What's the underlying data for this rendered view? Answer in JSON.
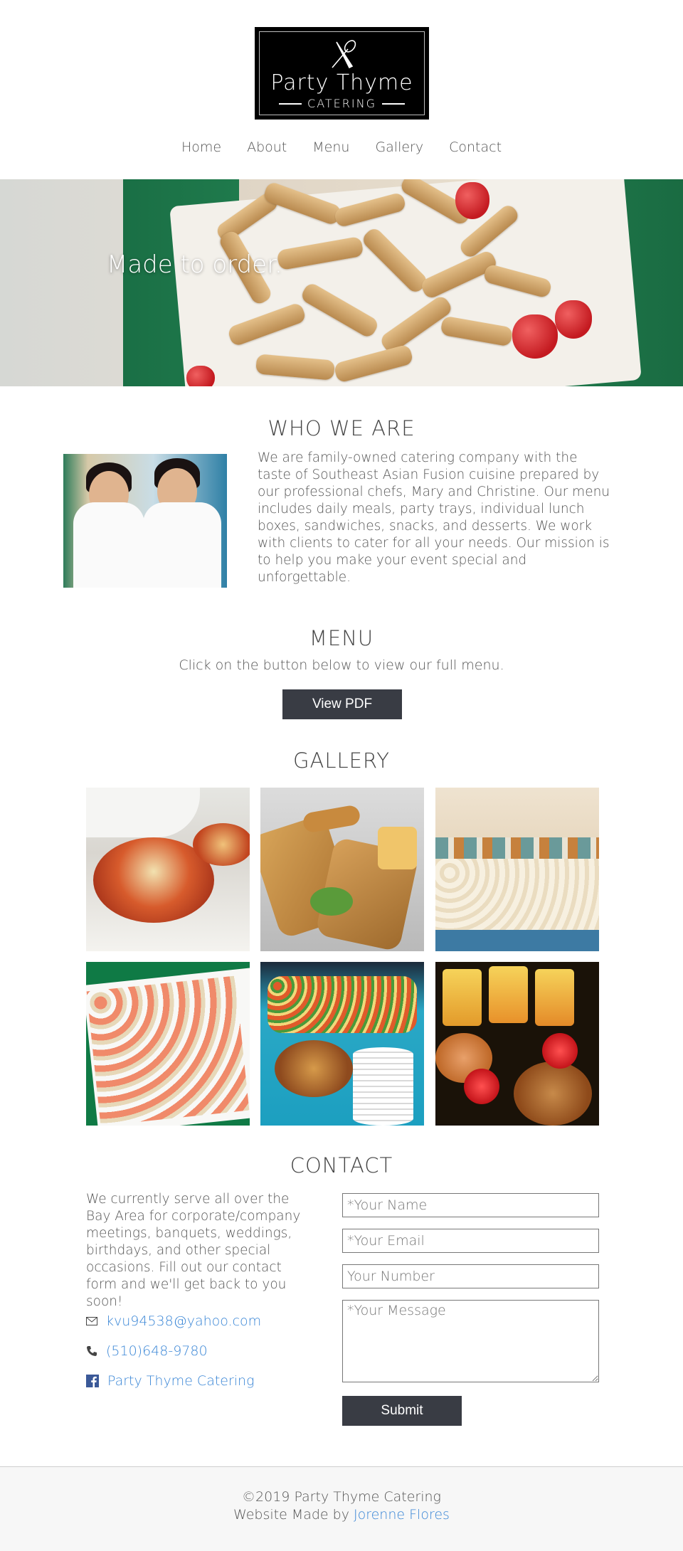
{
  "brand": {
    "logo_title": "Party Thyme",
    "logo_subtitle": "CATERING",
    "logo_icon": "whisk-knife-icon"
  },
  "nav": {
    "items": [
      {
        "label": "Home"
      },
      {
        "label": "About"
      },
      {
        "label": "Menu"
      },
      {
        "label": "Gallery"
      },
      {
        "label": "Contact"
      }
    ]
  },
  "hero": {
    "tagline": "Made to order."
  },
  "who": {
    "heading": "WHO WE ARE",
    "body": "We are family-owned catering company with the taste of Southeast Asian Fusion cuisine prepared by our professional chefs, Mary and Christine. Our menu includes daily meals, party trays, individual lunch boxes, sandwiches, snacks, and desserts. We work with clients to cater for all your needs. Our mission is to help you make your event special and unforgettable."
  },
  "menu": {
    "heading": "MENU",
    "subtitle": "Click on the button below to view our full menu.",
    "button_label": "View PDF"
  },
  "gallery": {
    "heading": "GALLERY"
  },
  "contact": {
    "heading": "CONTACT",
    "body": "We currently serve all over the Bay Area for corporate/company meetings, banquets, weddings, birthdays, and other special occasions. Fill out our contact form and we'll get back to you soon!",
    "email": "kvu94538@yahoo.com",
    "phone": "(510)648-9780",
    "facebook": "Party Thyme Catering",
    "form": {
      "name_placeholder": "*Your Name",
      "email_placeholder": "*Your Email",
      "number_placeholder": "Your Number",
      "message_placeholder": "*Your Message",
      "submit_label": "Submit"
    }
  },
  "footer": {
    "copyright": "©2019 Party Thyme Catering",
    "made_by_prefix": "Website Made by ",
    "author": "Jorenne Flores"
  },
  "colors": {
    "button": "#393c44",
    "link": "#3a86d6",
    "logo_bg": "#000000"
  }
}
